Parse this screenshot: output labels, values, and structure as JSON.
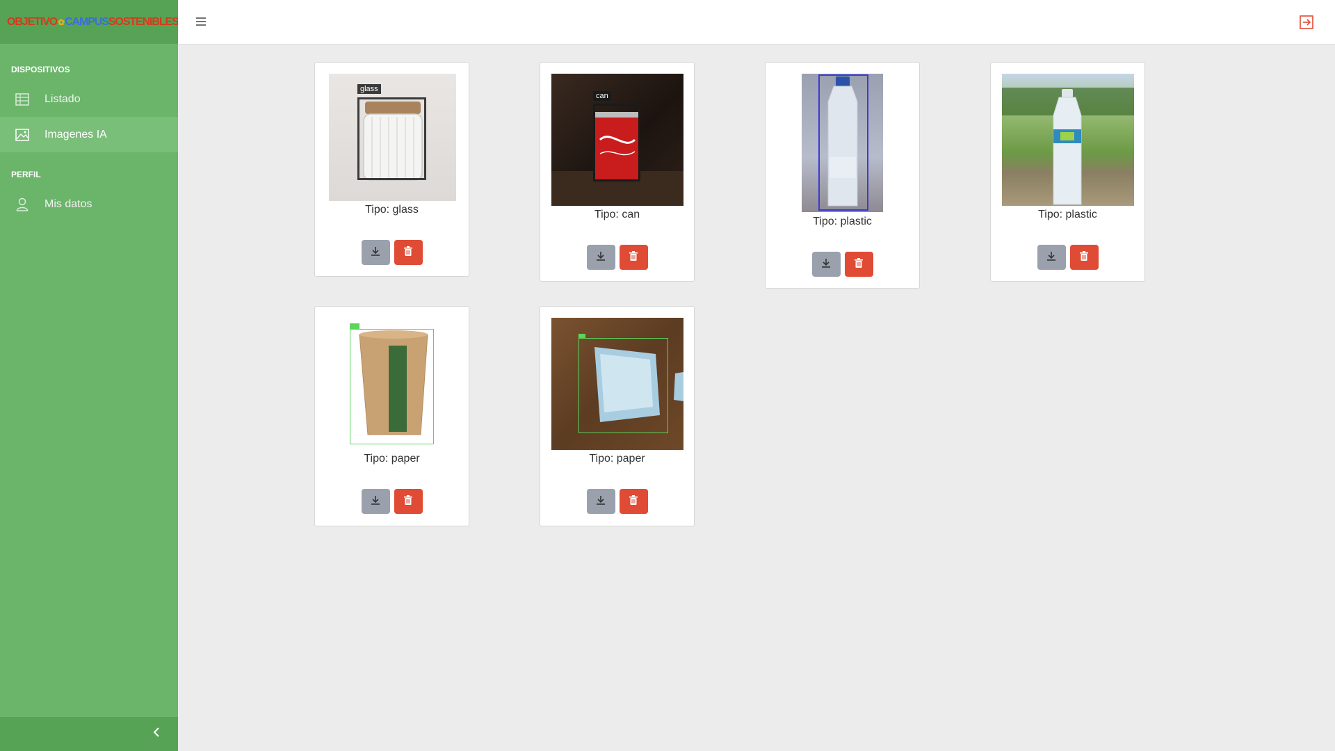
{
  "brand": {
    "w1": "OBJETIVO",
    "w2": "CAMPUS",
    "w3": "SOSTENIBLES"
  },
  "sidebar": {
    "sections": [
      {
        "title": "DISPOSITIVOS",
        "items": [
          {
            "label": "Listado",
            "icon": "table-icon"
          },
          {
            "label": "Imagenes IA",
            "icon": "image-icon",
            "active": true
          }
        ]
      },
      {
        "title": "PERFIL",
        "items": [
          {
            "label": "Mis datos",
            "icon": "user-icon"
          }
        ]
      }
    ]
  },
  "images": [
    {
      "caption": "Tipo: glass",
      "label": "glass"
    },
    {
      "caption": "Tipo: can",
      "label": "can"
    },
    {
      "caption": "Tipo: plastic"
    },
    {
      "caption": "Tipo: plastic"
    },
    {
      "caption": "Tipo: paper"
    },
    {
      "caption": "Tipo: paper"
    }
  ],
  "colors": {
    "sidebar": "#6bb56b",
    "sidebar_dark": "#56a356",
    "download": "#9aa1ad",
    "delete": "#df4b34",
    "logout": "#df4b34"
  }
}
